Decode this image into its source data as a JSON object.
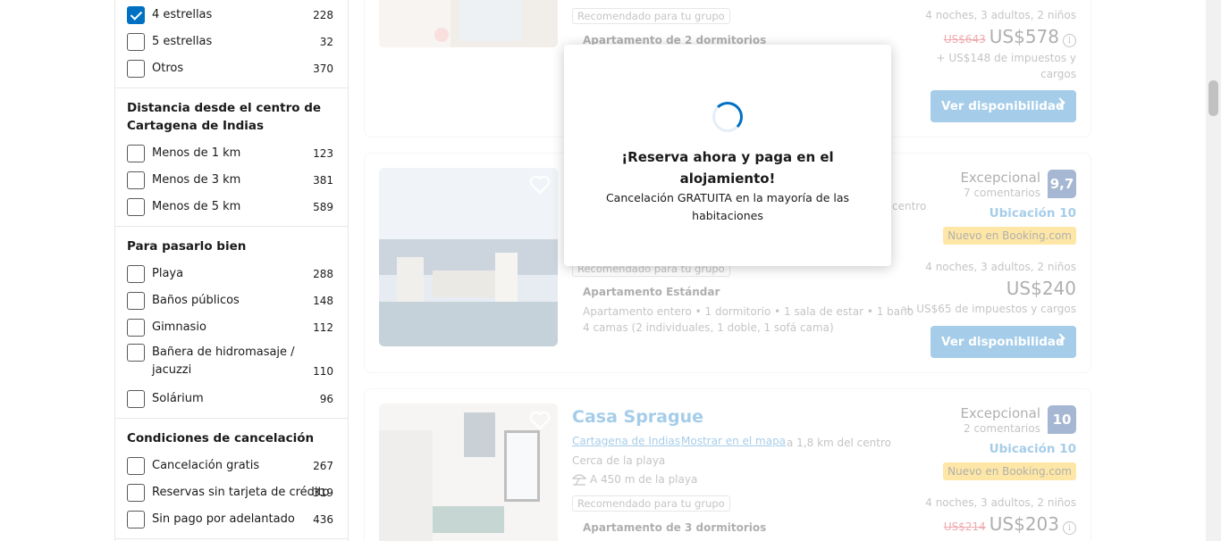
{
  "filters": {
    "stars": [
      {
        "label": "4 estrellas",
        "count": "228",
        "checked": true
      },
      {
        "label": "5 estrellas",
        "count": "32",
        "checked": false
      },
      {
        "label": "Otros",
        "count": "370",
        "checked": false
      }
    ],
    "distance_title": "Distancia desde el centro de Cartagena de Indias",
    "distance": [
      {
        "label": "Menos de 1 km",
        "count": "123"
      },
      {
        "label": "Menos de 3 km",
        "count": "381"
      },
      {
        "label": "Menos de 5 km",
        "count": "589"
      }
    ],
    "fun_title": "Para pasarlo bien",
    "fun": [
      {
        "label": "Playa",
        "count": "288"
      },
      {
        "label": "Baños públicos",
        "count": "148"
      },
      {
        "label": "Gimnasio",
        "count": "112"
      },
      {
        "label": "Bañera de hidromasaje / jacuzzi",
        "count": "110"
      },
      {
        "label": "Solárium",
        "count": "96"
      }
    ],
    "cancel_title": "Condiciones de cancelación",
    "cancel": [
      {
        "label": "Cancelación gratis",
        "count": "267"
      },
      {
        "label": "Reservas sin tarjeta de crédito",
        "count": "319"
      },
      {
        "label": "Sin pago por adelantado",
        "count": "436"
      }
    ]
  },
  "cards": [
    {
      "recommended": "Recomendado para tu grupo",
      "room_type": "Apartamento de 2 dormitorios",
      "stay": "4 noches, 3 adultos, 2 niños",
      "old_price": "US$643",
      "price": "US$578",
      "taxes": "+ US$148 de impuestos y cargos",
      "button": "Ver disponibilidad"
    },
    {
      "review_word": "Excepcional",
      "review_count": "7 comentarios",
      "score": "9,7",
      "location": "Ubicación 10",
      "new_badge": "Nuevo en Booking.com",
      "distance_partial": "centro",
      "recommended": "Recomendado para tu grupo",
      "room_type": "Apartamento Estándar",
      "room_desc": "Apartamento entero • 1 dormitorio • 1 sala de estar • 1 baño",
      "beds": "4 camas (2 individuales, 1 doble, 1 sofá cama)",
      "stay": "4 noches, 3 adultos, 2 niños",
      "price": "US$240",
      "taxes": "+ US$65 de impuestos y cargos",
      "button": "Ver disponibilidad"
    },
    {
      "name": "Casa Sprague",
      "city_link": "Cartagena de Indias",
      "map_link": "Mostrar en el mapa",
      "distance": "a 1,8 km del centro",
      "near_beach": "Cerca de la playa",
      "beach_distance": "A 450 m de la playa",
      "review_word": "Excepcional",
      "review_count": "2 comentarios",
      "score": "10",
      "location": "Ubicación 10",
      "new_badge": "Nuevo en Booking.com",
      "recommended": "Recomendado para tu grupo",
      "room_type": "Apartamento de 3 dormitorios",
      "stay": "4 noches, 3 adultos, 2 niños",
      "old_price": "US$214",
      "price": "US$203"
    }
  ],
  "modal": {
    "title": "¡Reserva ahora y paga en el alojamiento!",
    "subtitle": "Cancelación GRATUITA en la mayoría de las habitaciones"
  },
  "colors": {
    "brand_blue": "#0071c2",
    "score_navy": "#003580",
    "price_red": "#d4111e",
    "badge_yellow": "#febb02"
  }
}
